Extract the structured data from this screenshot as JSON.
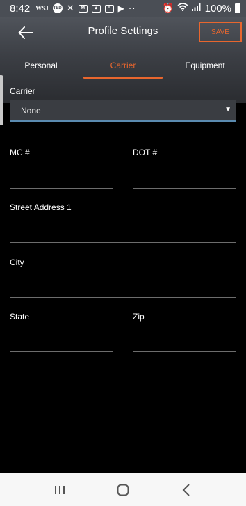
{
  "status_bar": {
    "time": "8:42",
    "icons_left": [
      "wsj-icon",
      "ted-icon",
      "missed-call-icon",
      "gmail-icon",
      "gallery-icon",
      "news-icon",
      "play-store-icon",
      "more-dots-icon"
    ],
    "icons_right": [
      "alarm-icon",
      "wifi-icon",
      "signal-icon"
    ],
    "battery": "100%"
  },
  "header": {
    "title": "Profile Settings",
    "save_label": "SAVE"
  },
  "tabs": [
    {
      "label": "Personal",
      "active": false
    },
    {
      "label": "Carrier",
      "active": true
    },
    {
      "label": "Equipment",
      "active": false
    }
  ],
  "form": {
    "carrier_label": "Carrier",
    "carrier_value": "None",
    "mc_label": "MC #",
    "dot_label": "DOT #",
    "street_label": "Street Address 1",
    "city_label": "City",
    "state_label": "State",
    "zip_label": "Zip"
  },
  "colors": {
    "accent": "#e8662e",
    "header_bg": "#50545b",
    "page_bg": "#000000"
  }
}
